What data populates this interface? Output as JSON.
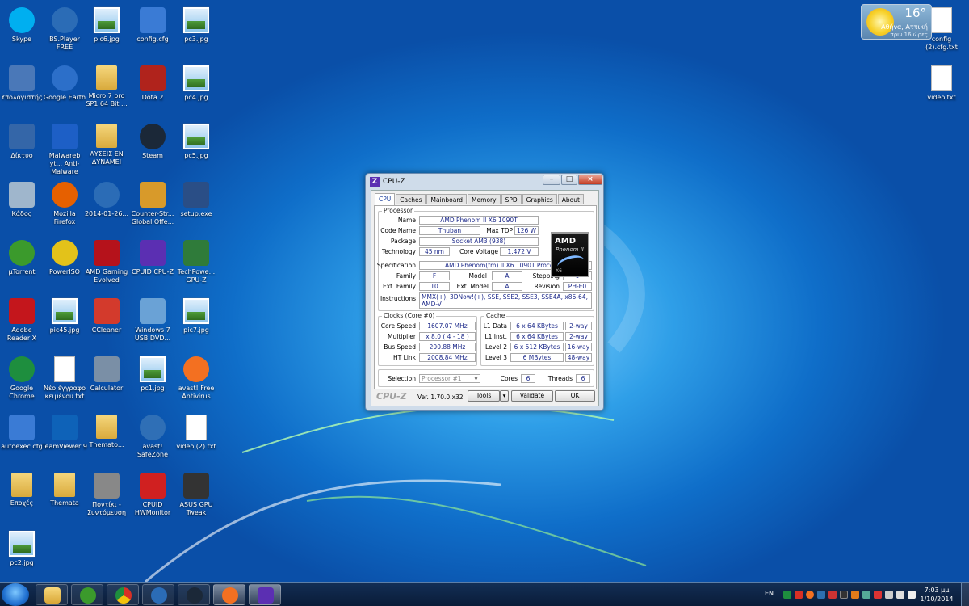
{
  "desktop": {
    "icons": [
      {
        "label": "Skype",
        "type": "skype"
      },
      {
        "label": "BS.Player FREE",
        "type": "bs"
      },
      {
        "label": "pic6.jpg",
        "type": "jpg"
      },
      {
        "label": "config.cfg",
        "type": "shield"
      },
      {
        "label": "pc3.jpg",
        "type": "jpg"
      },
      {
        "label": "Υπολογιστής",
        "type": "computer"
      },
      {
        "label": "Google Earth",
        "type": "earth"
      },
      {
        "label": "Micro 7 pro SP1 64 Bit ...",
        "type": "folder"
      },
      {
        "label": "Dota 2",
        "type": "dota"
      },
      {
        "label": "pc4.jpg",
        "type": "jpg"
      },
      {
        "label": "Δίκτυο",
        "type": "network"
      },
      {
        "label": "Malwareb yt... Anti-Malware",
        "type": "malware"
      },
      {
        "label": "ΛΥΣΕΙΣ ΕΝ ΔΥΝΑΜΕΙ",
        "type": "folder"
      },
      {
        "label": "Steam",
        "type": "steam"
      },
      {
        "label": "pc5.jpg",
        "type": "jpg"
      },
      {
        "label": "Κάδος",
        "type": "bin"
      },
      {
        "label": "Mozilla Firefox",
        "type": "firefox"
      },
      {
        "label": "2014-01-26...",
        "type": "bs"
      },
      {
        "label": "Counter-Str... Global Offe...",
        "type": "csgo"
      },
      {
        "label": "setup.exe",
        "type": "setup"
      },
      {
        "label": "µTorrent",
        "type": "utorrent"
      },
      {
        "label": "PowerISO",
        "type": "poweriso"
      },
      {
        "label": "AMD Gaming Evolved",
        "type": "amd"
      },
      {
        "label": "CPUID CPU-Z",
        "type": "cpuz"
      },
      {
        "label": "TechPowe... GPU-Z",
        "type": "gpuz"
      },
      {
        "label": "Adobe Reader X",
        "type": "adobe"
      },
      {
        "label": "pic45.jpg",
        "type": "jpg"
      },
      {
        "label": "CCleaner",
        "type": "ccleaner"
      },
      {
        "label": "Windows 7 USB DVD...",
        "type": "win7"
      },
      {
        "label": "pic7.jpg",
        "type": "jpg"
      },
      {
        "label": "Google Chrome",
        "type": "chrome"
      },
      {
        "label": "Νέο έγγραφο κειμένου.txt",
        "type": "doc"
      },
      {
        "label": "Calculator",
        "type": "calc"
      },
      {
        "label": "pc1.jpg",
        "type": "jpg"
      },
      {
        "label": "avast! Free Antivirus",
        "type": "avast"
      },
      {
        "label": "autoexec.cfg",
        "type": "shield"
      },
      {
        "label": "TeamViewer 9",
        "type": "teamviewer"
      },
      {
        "label": "Themato...",
        "type": "folder"
      },
      {
        "label": "avast! SafeZone",
        "type": "safezone"
      },
      {
        "label": "video (2).txt",
        "type": "doc"
      },
      {
        "label": "Εποχές",
        "type": "folder"
      },
      {
        "label": "Themata",
        "type": "folder"
      },
      {
        "label": "Ποντίκι - Συντόμευση",
        "type": "mouse"
      },
      {
        "label": "CPUID HWMonitor",
        "type": "hwmon"
      },
      {
        "label": "ASUS GPU Tweak",
        "type": "asus"
      },
      {
        "label": "pc2.jpg",
        "type": "jpg"
      },
      {
        "label": "config (2).cfg.txt",
        "type": "doc"
      },
      {
        "label": "video.txt",
        "type": "doc"
      }
    ]
  },
  "weather": {
    "temp": "16°",
    "city": "Αθήνα, Αττική",
    "sub": "πριν 16 ώρες"
  },
  "cpuz": {
    "title": "CPU-Z",
    "tabs": [
      "CPU",
      "Caches",
      "Mainboard",
      "Memory",
      "SPD",
      "Graphics",
      "About"
    ],
    "processor_title": "Processor",
    "labels": {
      "name": "Name",
      "code": "Code Name",
      "tdp": "Max TDP",
      "package": "Package",
      "tech": "Technology",
      "voltage": "Core Voltage",
      "spec": "Specification",
      "family": "Family",
      "model": "Model",
      "stepping": "Stepping",
      "extfamily": "Ext. Family",
      "extmodel": "Ext. Model",
      "revision": "Revision",
      "instructions": "Instructions"
    },
    "values": {
      "name": "AMD Phenom II X6 1090T",
      "code": "Thuban",
      "tdp": "126 W",
      "package": "Socket AM3 (938)",
      "tech": "45 nm",
      "voltage": "1.472 V",
      "spec": "AMD Phenom(tm) II X6 1090T Processor",
      "family": "F",
      "model": "A",
      "stepping": "0",
      "extfamily": "10",
      "extmodel": "A",
      "revision": "PH-E0",
      "instructions": "MMX(+), 3DNow!(+), SSE, SSE2, SSE3, SSE4A, x86-64, AMD-V"
    },
    "logo": {
      "brand": "AMD",
      "sub": "Phenom II",
      "x": "X6"
    },
    "clocks": {
      "title": "Clocks (Core #0)",
      "core_speed_label": "Core Speed",
      "core_speed": "1607.07 MHz",
      "multiplier_label": "Multiplier",
      "multiplier": "x 8.0 ( 4 - 18 )",
      "bus_label": "Bus Speed",
      "bus": "200.88 MHz",
      "ht_label": "HT Link",
      "ht": "2008.84 MHz"
    },
    "cache": {
      "title": "Cache",
      "rows": [
        {
          "label": "L1 Data",
          "size": "6 x 64 KBytes",
          "way": "2-way"
        },
        {
          "label": "L1 Inst.",
          "size": "6 x 64 KBytes",
          "way": "2-way"
        },
        {
          "label": "Level 2",
          "size": "6 x 512 KBytes",
          "way": "16-way"
        },
        {
          "label": "Level 3",
          "size": "6 MBytes",
          "way": "48-way"
        }
      ]
    },
    "selection": {
      "label": "Selection",
      "value": "Processor #1",
      "cores_label": "Cores",
      "cores": "6",
      "threads_label": "Threads",
      "threads": "6"
    },
    "footer": {
      "brand": "CPU-Z",
      "version": "Ver. 1.70.0.x32",
      "tools": "Tools",
      "validate": "Validate",
      "ok": "OK"
    }
  },
  "taskbar": {
    "lang": "EN",
    "time": "7:03 μμ",
    "date": "1/10/2014"
  }
}
